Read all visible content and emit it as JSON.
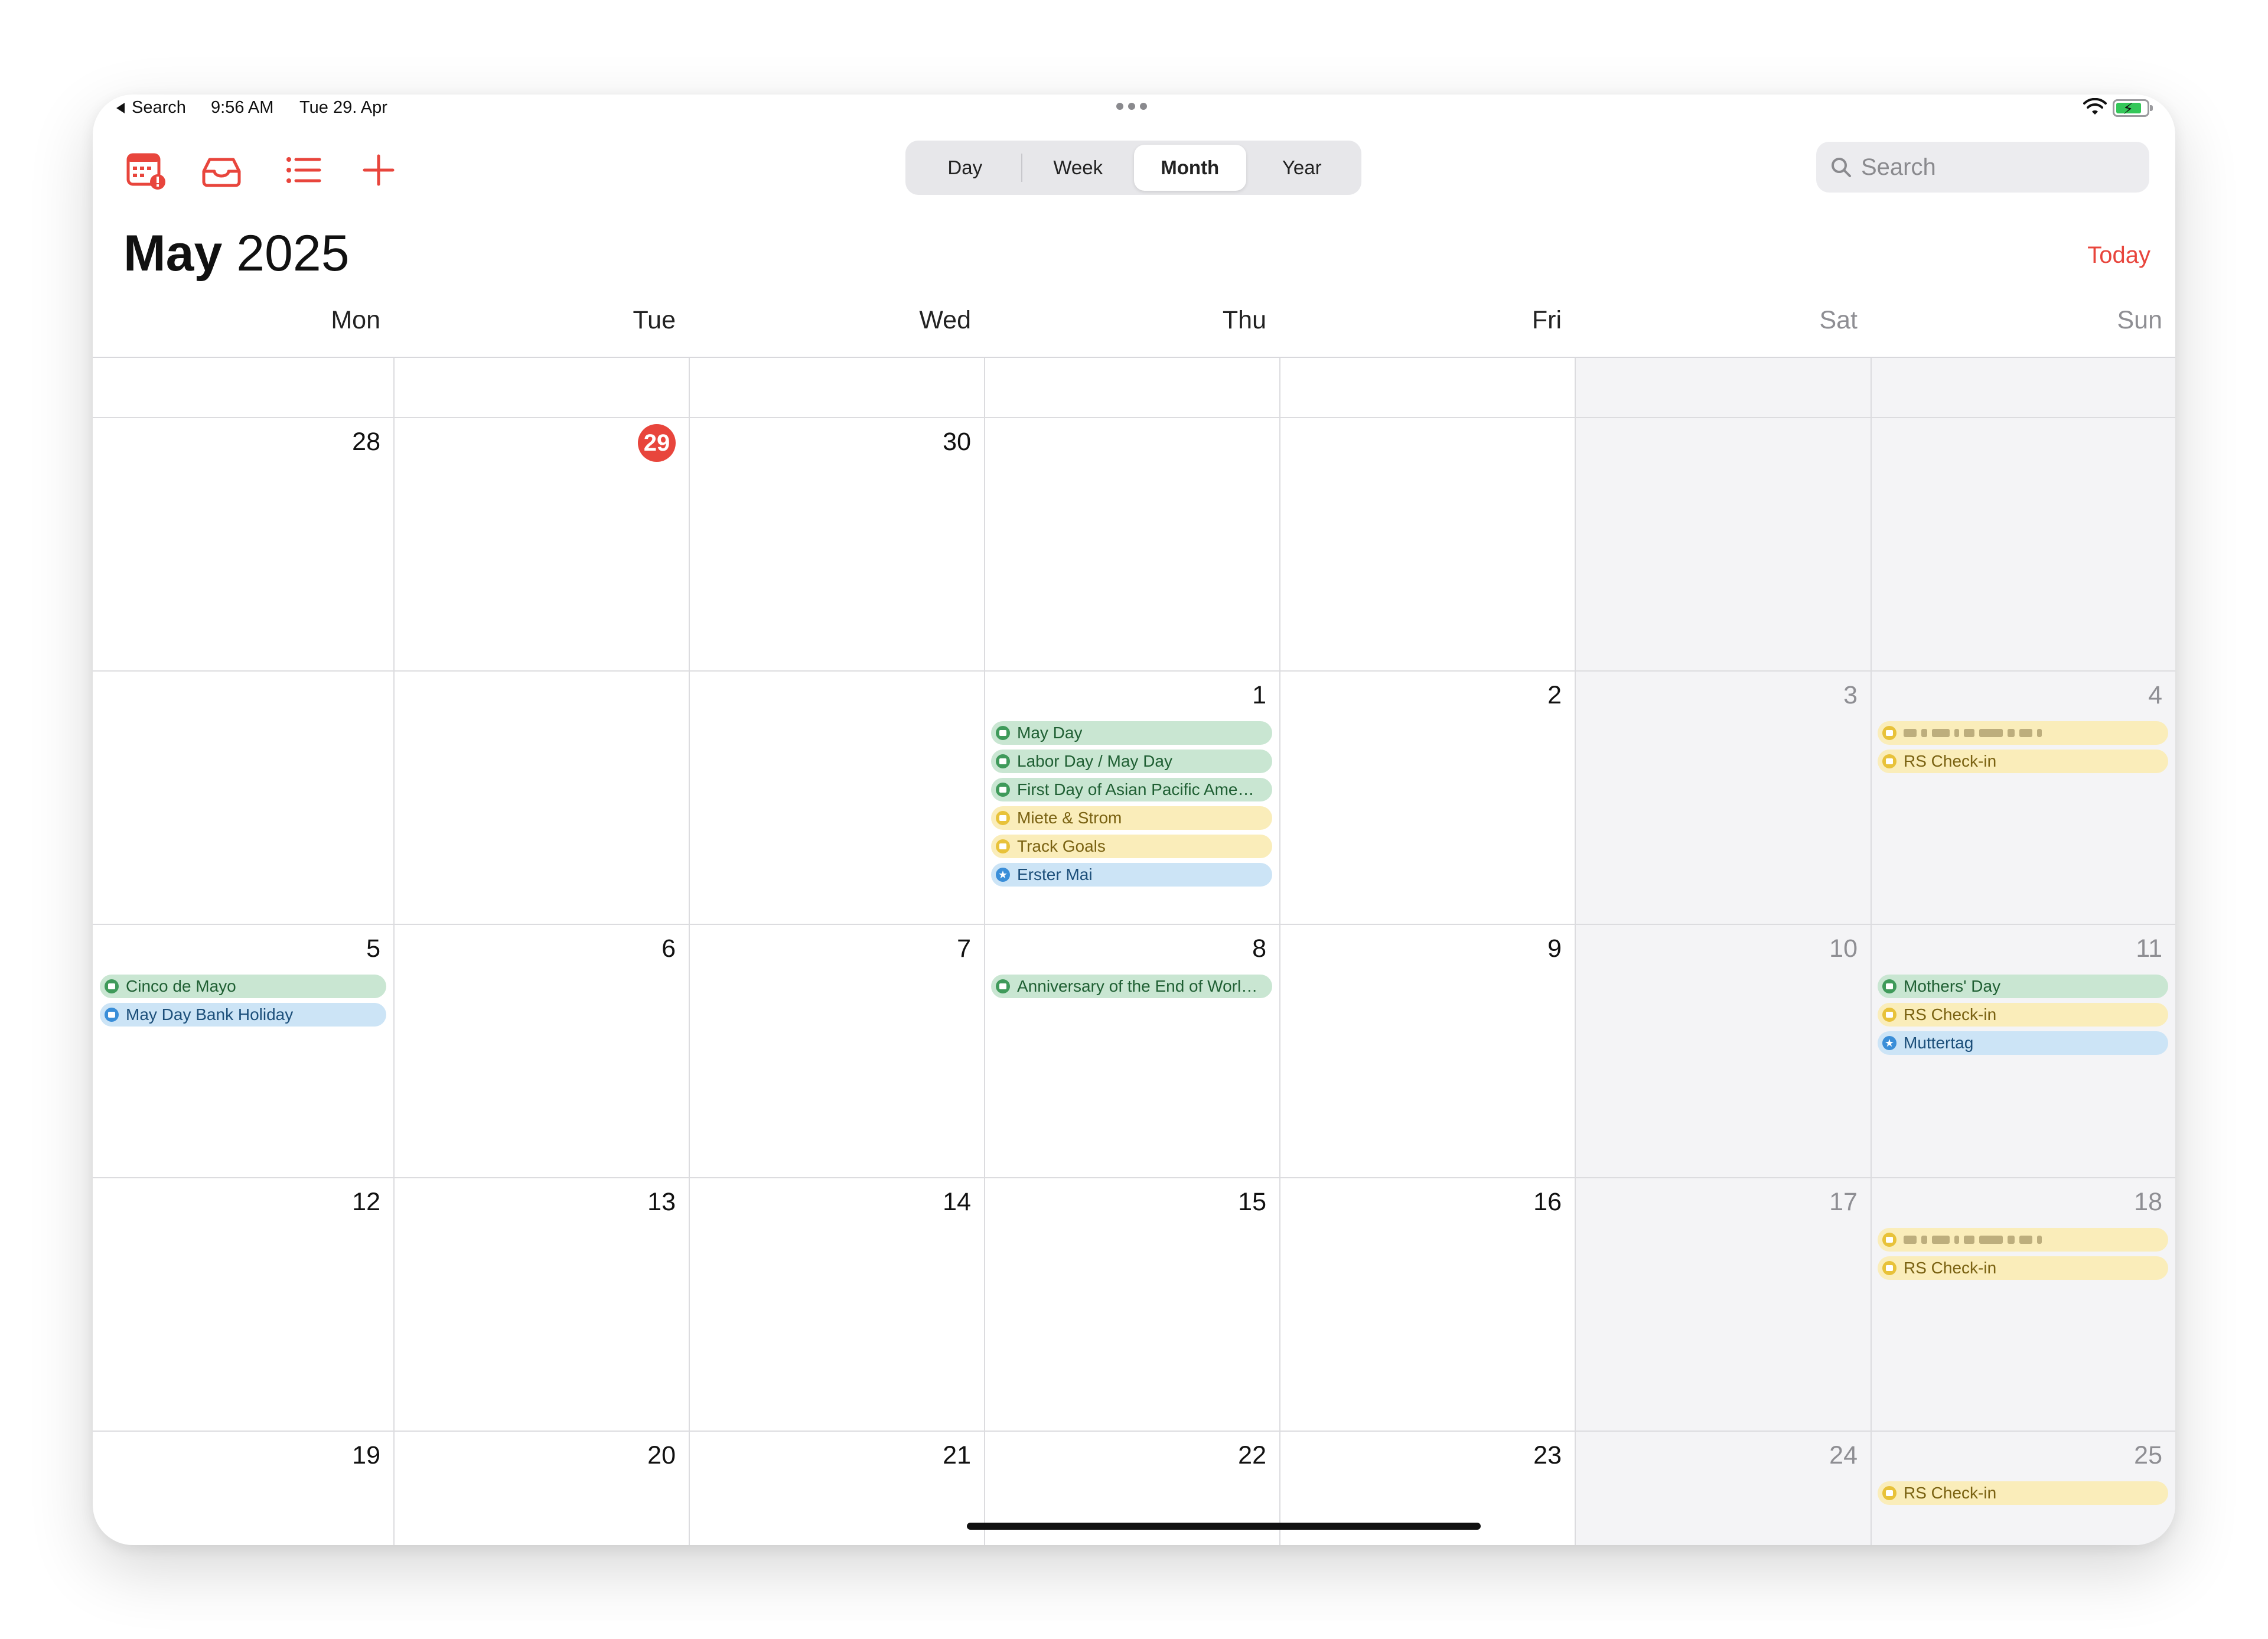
{
  "status_bar": {
    "back_label": "Search",
    "time": "9:56 AM",
    "date": "Tue 29. Apr"
  },
  "toolbar": {
    "icons": [
      "calendar-badge-icon",
      "inbox-icon",
      "list-icon",
      "plus-icon"
    ],
    "segments": [
      "Day",
      "Week",
      "Month",
      "Year"
    ],
    "active_segment": "Month",
    "search_placeholder": "Search"
  },
  "header": {
    "month": "May",
    "year": "2025",
    "today_label": "Today"
  },
  "weekdays": [
    "Mon",
    "Tue",
    "Wed",
    "Thu",
    "Fri",
    "Sat",
    "Sun"
  ],
  "colors": {
    "accent": "#e8453c",
    "green_event": "#c9e6d2",
    "yellow_event": "#faedba",
    "blue_event": "#cce4f6"
  },
  "weeks": [
    {
      "days": [
        {
          "num": "28",
          "events": []
        },
        {
          "num": "29",
          "today": true,
          "events": []
        },
        {
          "num": "30",
          "events": []
        },
        {
          "num": "",
          "events": []
        },
        {
          "num": "",
          "events": []
        },
        {
          "num": "",
          "events": []
        },
        {
          "num": "",
          "events": []
        }
      ]
    },
    {
      "days": [
        {
          "num": "",
          "events": []
        },
        {
          "num": "",
          "events": []
        },
        {
          "num": "",
          "events": []
        },
        {
          "num": "1",
          "events": [
            {
              "title": "May Day",
              "color": "green",
              "icon": "calendar"
            },
            {
              "title": "Labor Day / May Day",
              "color": "green",
              "icon": "calendar"
            },
            {
              "title": "First Day of Asian Pacific Ame…",
              "color": "green",
              "icon": "calendar"
            },
            {
              "title": "Miete & Strom",
              "color": "yellow",
              "icon": "calendar"
            },
            {
              "title": "Track Goals",
              "color": "yellow",
              "icon": "calendar"
            },
            {
              "title": "Erster Mai",
              "color": "blue",
              "icon": "star"
            }
          ]
        },
        {
          "num": "2",
          "events": []
        },
        {
          "num": "3",
          "events": []
        },
        {
          "num": "4",
          "events": [
            {
              "title": "",
              "color": "yellow",
              "icon": "calendar",
              "blurred": true
            },
            {
              "title": "RS Check-in",
              "color": "yellow",
              "icon": "calendar"
            }
          ]
        }
      ]
    },
    {
      "days": [
        {
          "num": "5",
          "events": [
            {
              "title": "Cinco de Mayo",
              "color": "green",
              "icon": "calendar"
            },
            {
              "title": "May Day Bank Holiday",
              "color": "blue",
              "icon": "calendar"
            }
          ]
        },
        {
          "num": "6",
          "events": []
        },
        {
          "num": "7",
          "events": []
        },
        {
          "num": "8",
          "events": [
            {
              "title": "Anniversary of the End of Worl…",
              "color": "green",
              "icon": "calendar"
            }
          ]
        },
        {
          "num": "9",
          "events": []
        },
        {
          "num": "10",
          "events": []
        },
        {
          "num": "11",
          "events": [
            {
              "title": "Mothers' Day",
              "color": "green",
              "icon": "calendar"
            },
            {
              "title": "RS Check-in",
              "color": "yellow",
              "icon": "calendar"
            },
            {
              "title": "Muttertag",
              "color": "blue",
              "icon": "star"
            }
          ]
        }
      ]
    },
    {
      "days": [
        {
          "num": "12",
          "events": []
        },
        {
          "num": "13",
          "events": []
        },
        {
          "num": "14",
          "events": []
        },
        {
          "num": "15",
          "events": []
        },
        {
          "num": "16",
          "events": []
        },
        {
          "num": "17",
          "events": []
        },
        {
          "num": "18",
          "events": [
            {
              "title": "",
              "color": "yellow",
              "icon": "calendar",
              "blurred": true
            },
            {
              "title": "RS Check-in",
              "color": "yellow",
              "icon": "calendar"
            }
          ]
        }
      ]
    },
    {
      "days": [
        {
          "num": "19",
          "events": []
        },
        {
          "num": "20",
          "events": []
        },
        {
          "num": "21",
          "events": []
        },
        {
          "num": "22",
          "events": []
        },
        {
          "num": "23",
          "events": []
        },
        {
          "num": "24",
          "events": []
        },
        {
          "num": "25",
          "events": [
            {
              "title": "RS Check-in",
              "color": "yellow",
              "icon": "calendar"
            }
          ]
        }
      ]
    }
  ]
}
